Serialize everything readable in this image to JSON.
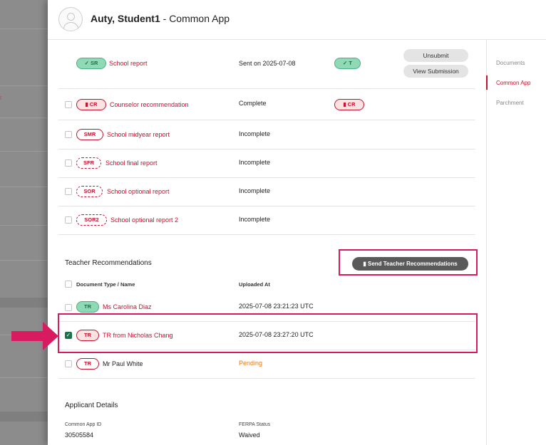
{
  "header": {
    "student_name": "Auty, Student1",
    "app_suffix": " - Common App"
  },
  "right_nav": {
    "items": [
      "Documents",
      "Common App",
      "Parchment"
    ],
    "active": "Common App"
  },
  "school_forms": [
    {
      "badge": "SR",
      "badge_prefix": "✓",
      "label": "School report",
      "status": "Sent on 2025-07-08",
      "status_badge": "✓ T",
      "actions": [
        "Unsubmit",
        "View Submission"
      ]
    },
    {
      "badge": "CR",
      "badge_prefix": "▮",
      "label": "Counselor recommendation",
      "status": "Complete",
      "status_badge": "▮ CR"
    },
    {
      "badge": "SMR",
      "label": "School midyear report",
      "status": "Incomplete"
    },
    {
      "badge": "SFR",
      "label": "School final report",
      "status": "Incomplete"
    },
    {
      "badge": "SOR",
      "label": "School optional report",
      "status": "Incomplete"
    },
    {
      "badge": "SOR2",
      "label": "School optional report 2",
      "status": "Incomplete"
    }
  ],
  "teacher_recs": {
    "title": "Teacher Recommendations",
    "send_button": "Send Teacher Recommendations",
    "col_doc_type": "Document Type / Name",
    "col_uploaded": "Uploaded At",
    "rows": [
      {
        "badge": "TR",
        "name": "Ms Carolina Diaz",
        "uploaded": "2025-07-08 23:21:23 UTC",
        "checked": false
      },
      {
        "badge": "TR",
        "name": "TR from Nicholas Chang",
        "uploaded": "2025-07-08 23:27:20 UTC",
        "checked": true
      },
      {
        "badge": "TR",
        "name": "Mr Paul White",
        "uploaded": "Pending",
        "checked": false
      }
    ]
  },
  "applicant": {
    "title": "Applicant Details",
    "app_id_label": "Common App ID",
    "app_id": "30505584",
    "ferpa_label": "FERPA Status",
    "ferpa": "Waived"
  },
  "bg_fragment": "r",
  "colors": {
    "accent": "#c8102e",
    "highlight": "#d81b60",
    "green": "#8fd9b6"
  }
}
